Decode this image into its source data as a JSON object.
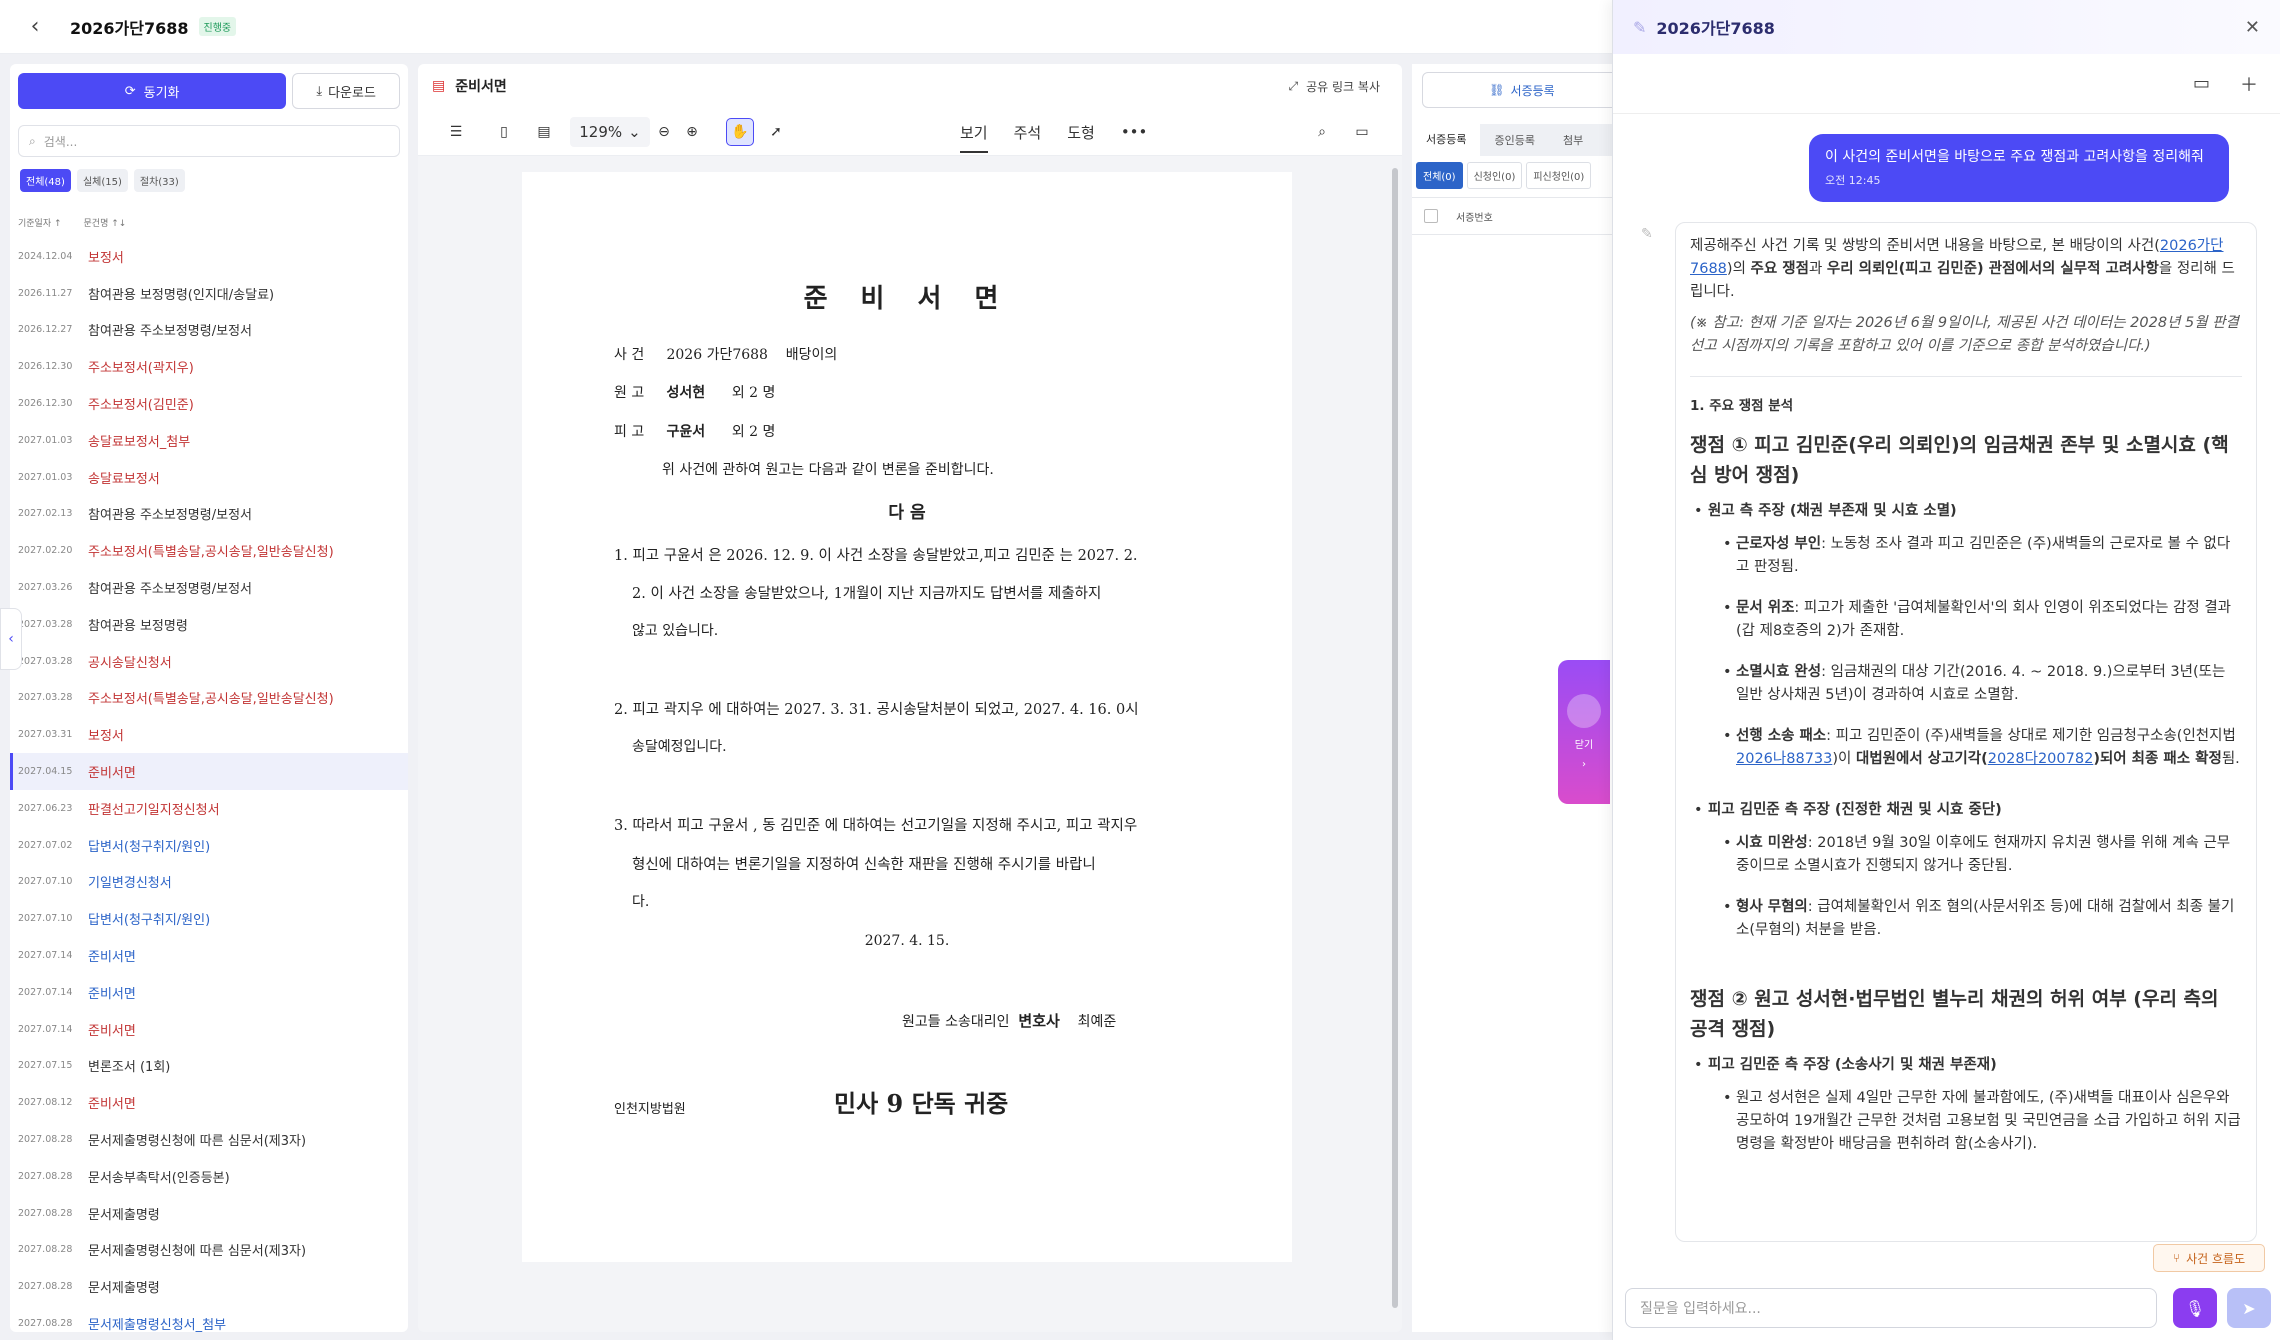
{
  "header": {
    "title": "2026가단7688",
    "badge": "진행중"
  },
  "left": {
    "sync_label": "동기화",
    "download_label": "다운로드",
    "search_placeholder": "검색...",
    "filters": [
      {
        "label": "전체(48)"
      },
      {
        "label": "실체(15)"
      },
      {
        "label": "절차(33)"
      }
    ],
    "col_date": "기준일자 ↑",
    "col_doc": "문건명 ↑↓",
    "rows": [
      {
        "date": "2024.12.04",
        "name": "보정서",
        "color": "red"
      },
      {
        "date": "2026.11.27",
        "name": "참여관용 보정명령(인지대/송달료)",
        "color": "dark"
      },
      {
        "date": "2026.12.27",
        "name": "참여관용 주소보정명령/보정서",
        "color": "dark"
      },
      {
        "date": "2026.12.30",
        "name": "주소보정서(곽지우)",
        "color": "red"
      },
      {
        "date": "2026.12.30",
        "name": "주소보정서(김민준)",
        "color": "red"
      },
      {
        "date": "2027.01.03",
        "name": "송달료보정서_첨부",
        "color": "red"
      },
      {
        "date": "2027.01.03",
        "name": "송달료보정서",
        "color": "red"
      },
      {
        "date": "2027.02.13",
        "name": "참여관용 주소보정명령/보정서",
        "color": "dark"
      },
      {
        "date": "2027.02.20",
        "name": "주소보정서(특별송달,공시송달,일반송달신청)",
        "color": "red"
      },
      {
        "date": "2027.03.26",
        "name": "참여관용 주소보정명령/보정서",
        "color": "dark"
      },
      {
        "date": "2027.03.28",
        "name": "참여관용 보정명령",
        "color": "dark"
      },
      {
        "date": "2027.03.28",
        "name": "공시송달신청서",
        "color": "red"
      },
      {
        "date": "2027.03.28",
        "name": "주소보정서(특별송달,공시송달,일반송달신청)",
        "color": "red"
      },
      {
        "date": "2027.03.31",
        "name": "보정서",
        "color": "red"
      },
      {
        "date": "2027.04.15",
        "name": "준비서면",
        "color": "red",
        "selected": true
      },
      {
        "date": "2027.06.23",
        "name": "판결선고기일지정신청서",
        "color": "red"
      },
      {
        "date": "2027.07.02",
        "name": "답변서(청구취지/원인)",
        "color": "blue"
      },
      {
        "date": "2027.07.10",
        "name": "기일변경신청서",
        "color": "blue"
      },
      {
        "date": "2027.07.10",
        "name": "답변서(청구취지/원인)",
        "color": "blue"
      },
      {
        "date": "2027.07.14",
        "name": "준비서면",
        "color": "blue"
      },
      {
        "date": "2027.07.14",
        "name": "준비서면",
        "color": "blue"
      },
      {
        "date": "2027.07.14",
        "name": "준비서면",
        "color": "red"
      },
      {
        "date": "2027.07.15",
        "name": "변론조서 (1회)",
        "color": "dark"
      },
      {
        "date": "2027.08.12",
        "name": "준비서면",
        "color": "red"
      },
      {
        "date": "2027.08.28",
        "name": "문서제출명령신청에 따른 심문서(제3자)",
        "color": "dark"
      },
      {
        "date": "2027.08.28",
        "name": "문서송부촉탁서(인증등본)",
        "color": "dark"
      },
      {
        "date": "2027.08.28",
        "name": "문서제출명령",
        "color": "dark"
      },
      {
        "date": "2027.08.28",
        "name": "문서제출명령신청에 따른 심문서(제3자)",
        "color": "dark"
      },
      {
        "date": "2027.08.28",
        "name": "문서제출명령",
        "color": "dark"
      },
      {
        "date": "2027.08.28",
        "name": "문서제출명령신청서_첨부",
        "color": "blue"
      }
    ]
  },
  "doc": {
    "title": "준비서면",
    "share": "공유 링크 복사",
    "zoom": "129%",
    "tabs": [
      "보기",
      "주석",
      "도형"
    ],
    "paper": {
      "title": "준 비 서 면",
      "l1a": "사   건",
      "l1b": "2026 가단7688",
      "l1c": "배당이의",
      "l2a": "원   고",
      "l2b": "성서현",
      "l2c": "외 2 명",
      "l3a": "피   고",
      "l3b": "구윤서",
      "l3c": "외 2 명",
      "intro": "위 사건에 관하여 원고는 다음과 같이 변론을 준비합니다.",
      "next": "다      음",
      "p1a": "1. 피고 구윤서 은 2026. 12. 9. 이 사건 소장을 송달받았고,피고 김민준 는 2027. 2.",
      "p1b": "2. 이 사건 소장을 송달받았으나,  1개월이 지난 지금까지도 답변서를 제출하지",
      "p1c": "않고 있습니다.",
      "p2a": "2. 피고 곽지우 에 대하여는 2027. 3. 31. 공시송달처분이 되었고, 2027. 4. 16. 0시",
      "p2b": "송달예정입니다.",
      "p3a": "3. 따라서 피고 구윤서 , 동 김민준 에 대하여는 선고기일을 지정해 주시고, 피고 곽지우",
      "p3b": "형신에 대하여는 변론기일을 지정하여 신속한 재판을 진행해 주시기를 바랍니",
      "p3c": "다.",
      "date": "2027.  4.  15.",
      "sign_a": "원고들 소송대리인",
      "sign_b": "변호사",
      "sign_c": "최예준",
      "court": "인천지방법원",
      "court2": "민사 9 단독   귀중"
    }
  },
  "mid": {
    "seo": "서증등록",
    "tabs": [
      "서증등록",
      "증인등록",
      "첨부"
    ],
    "subtabs": [
      "전체(0)",
      "신청인(0)",
      "피신청인(0)"
    ],
    "col": "서증번호",
    "float_label": "닫기"
  },
  "chat": {
    "title": "2026가단7688",
    "user_msg": "이 사건의 준비서면을 바탕으로 주요 쟁점과 고려사항을 정리해줘",
    "user_time": "오전 12:45",
    "a1": "제공해주신 사건 기록 및 쌍방의 준비서면 내용을 바탕으로, 본 배당이의 사건(",
    "a1_link": "2026가단7688",
    "a1b": ")의 ",
    "a1_b1": "주요 쟁점",
    "a1c": "과 ",
    "a1_b2": "우리 의뢰인(피고 김민준) 관점에서의 실무적 고려사항",
    "a1d": "을 정리해 드립니다.",
    "note": "(※ 참고: 현재 기준 일자는 2026년 6월 9일이나, 제공된 사건 데이터는 2028년 5월 판결 선고 시점까지의 기록을 포함하고 있어 이를 기준으로 종합 분석하였습니다.)",
    "sec": "1. 주요 쟁점 분석",
    "h1": "쟁점 ① 피고 김민준(우리 의뢰인)의 임금채권 존부 및 소멸시효 (핵심 방어 쟁점)",
    "g1": "원고 측 주장 (채권 부존재 및 시효 소멸)",
    "g1i1b": "근로자성 부인",
    "g1i1": ": 노동청 조사 결과 피고 김민준은 (주)새벽들의 근로자로 볼 수 없다고 판정됨.",
    "g1i2b": "문서 위조",
    "g1i2": ": 피고가 제출한 '급여체불확인서'의 회사 인영이 위조되었다는 감정 결과(갑 제8호증의 2)가 존재함.",
    "g1i3b": "소멸시효 완성",
    "g1i3": ": 임금채권의 대상 기간(2016. 4. ~ 2018. 9.)으로부터 3년(또는 일반 상사채권 5년)이 경과하여 시효로 소멸함.",
    "g1i4b": "선행 소송 패소",
    "g1i4": ": 피고 김민준이 (주)새벽들을 상대로 제기한 임금청구소송(인천지법 ",
    "g1i4_link": "2026나88733",
    "g1i4c": ")이 ",
    "g1i4_b2": "대법원에서 상고기각(",
    "g1i4_link2": "2028다200782",
    "g1i4_b3": ")되어 최종 패소 확정",
    "g1i4d": "됨.",
    "g2": "피고 김민준 측 주장 (진정한 채권 및 시효 중단)",
    "g2i1b": "시효 미완성",
    "g2i1": ": 2018년 9월 30일 이후에도 현재까지 유치권 행사를 위해 계속 근무 중이므로 소멸시효가 진행되지 않거나 중단됨.",
    "g2i2b": "형사 무혐의",
    "g2i2": ": 급여체불확인서 위조 혐의(사문서위조 등)에 대해 검찰에서 최종 불기소(무혐의) 처분을 받음.",
    "h2": "쟁점 ② 원고 성서현·법무법인 별누리 채권의 허위 여부 (우리 측의 공격 쟁점)",
    "g3": "피고 김민준 측 주장 (소송사기 및 채권 부존재)",
    "g3i1": "원고 성서현은 실제 4일만 근무한 자에 불과함에도, (주)새벽들 대표이사 심은우와 공모하여 19개월간 근무한 것처럼 고용보험 및 국민연금을 소급 가입하고 허위 지급명령을 확정받아 배당금을 편취하려 함(소송사기).",
    "flow": "사건 흐름도",
    "input_placeholder": "질문을 입력하세요..."
  }
}
